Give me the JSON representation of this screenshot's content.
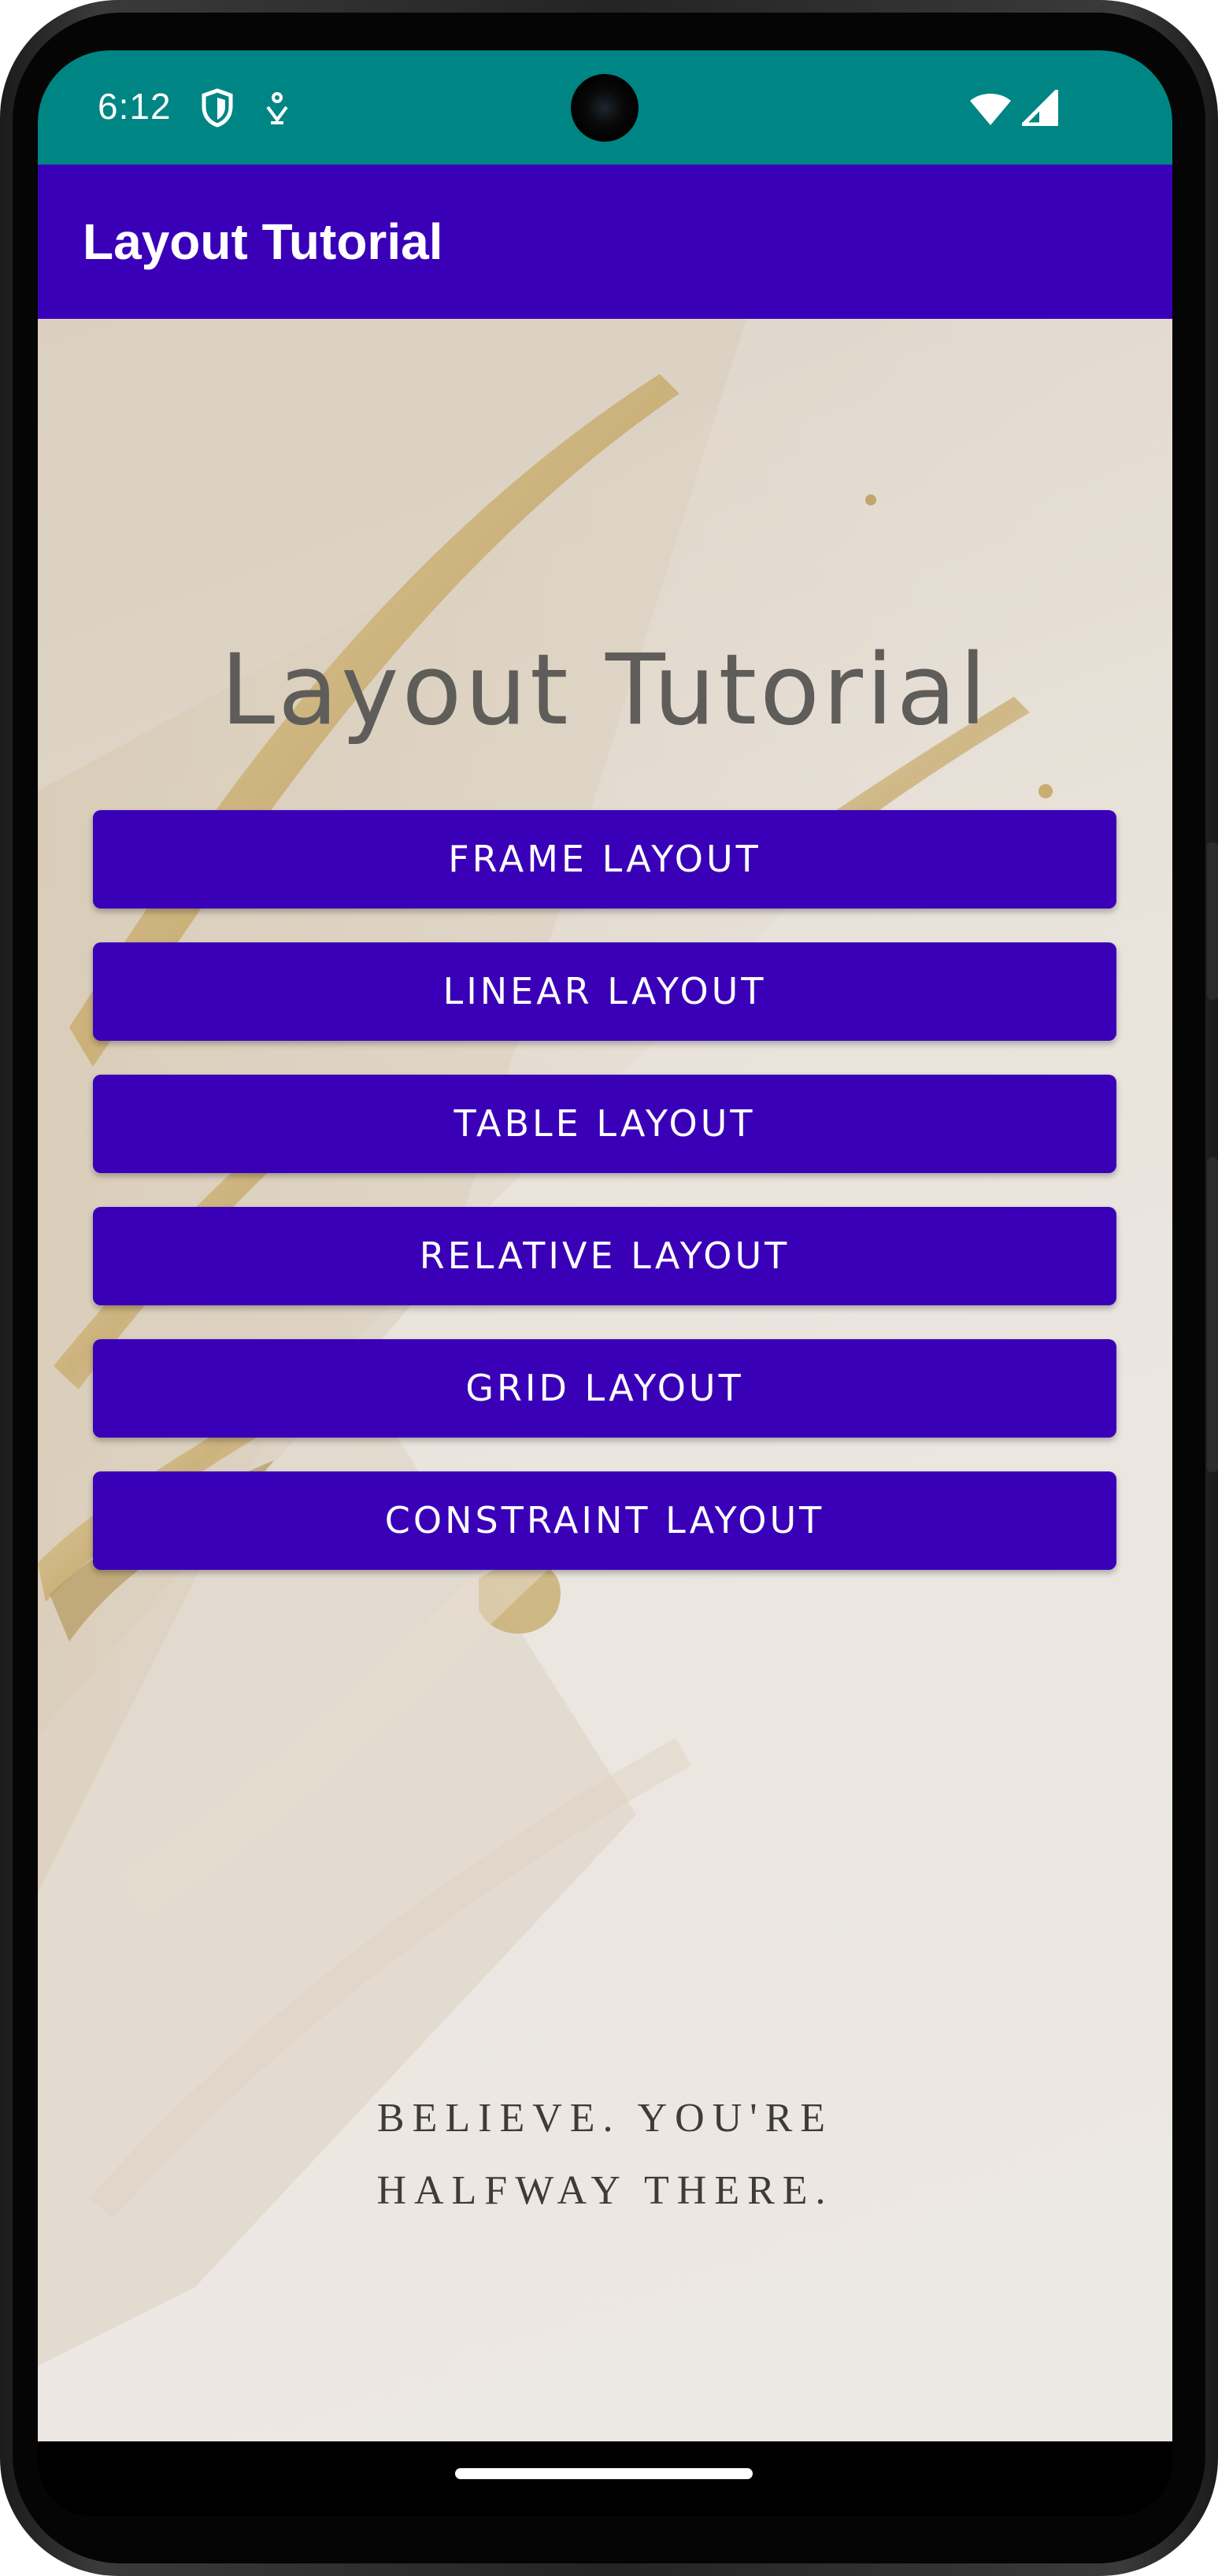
{
  "status_bar": {
    "time": "6:12",
    "background_color": "#008585",
    "icons": [
      "shield-icon",
      "notification-icon",
      "wifi-icon",
      "cell-signal-icon"
    ]
  },
  "app_bar": {
    "title": "Layout Tutorial",
    "background_color": "#3a00b8"
  },
  "main": {
    "heading": "Layout Tutorial",
    "buttons": [
      {
        "label": "FRAME LAYOUT"
      },
      {
        "label": "LINEAR LAYOUT"
      },
      {
        "label": "TABLE LAYOUT"
      },
      {
        "label": "RELATIVE LAYOUT"
      },
      {
        "label": "GRID LAYOUT"
      },
      {
        "label": "CONSTRAINT LAYOUT"
      }
    ],
    "button_color": "#3a00b8",
    "quote_line_1": "BELIEVE. YOU'RE",
    "quote_line_2": "HALFWAY THERE."
  },
  "nav_bar": {
    "handle": "home-handle"
  }
}
